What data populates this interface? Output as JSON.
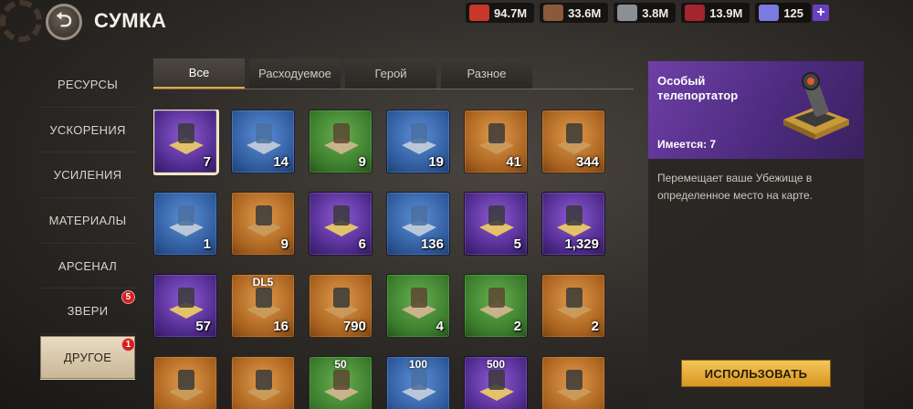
{
  "header": {
    "title": "СУМКА",
    "resources": [
      {
        "icon": "food-icon",
        "value": "94.7M",
        "color": "#c8372a"
      },
      {
        "icon": "wood-icon",
        "value": "33.6M",
        "color": "#8a5a3a"
      },
      {
        "icon": "steel-icon",
        "value": "3.8M",
        "color": "#8b8f96"
      },
      {
        "icon": "fuel-icon",
        "value": "13.9M",
        "color": "#a3252d"
      },
      {
        "icon": "gems-icon",
        "value": "125",
        "color": "#7a7ae0"
      }
    ],
    "plus_label": "+"
  },
  "sidebar": {
    "items": [
      {
        "label": "РЕСУРСЫ",
        "badge": null
      },
      {
        "label": "УСКОРЕНИЯ",
        "badge": null
      },
      {
        "label": "УСИЛЕНИЯ",
        "badge": null
      },
      {
        "label": "МАТЕРИАЛЫ",
        "badge": null
      },
      {
        "label": "АРСЕНАЛ",
        "badge": null
      },
      {
        "label": "ЗВЕРИ",
        "badge": "5"
      },
      {
        "label": "ДРУГОЕ",
        "badge": "1"
      }
    ],
    "active_index": 6
  },
  "tabs": [
    {
      "label": "Все",
      "active": true
    },
    {
      "label": "Расходуемое",
      "active": false
    },
    {
      "label": "Герой",
      "active": false
    },
    {
      "label": "Разное",
      "active": false
    }
  ],
  "items": [
    {
      "name": "teleporter-item",
      "rarity": "purple",
      "qty": "7",
      "selected": true
    },
    {
      "name": "flag-item",
      "rarity": "blue",
      "qty": "14"
    },
    {
      "name": "random-box-item",
      "rarity": "green",
      "qty": "9"
    },
    {
      "name": "map-search-item",
      "rarity": "blue",
      "qty": "19"
    },
    {
      "name": "binoculars-item",
      "rarity": "orange",
      "qty": "41"
    },
    {
      "name": "device-item",
      "rarity": "orange",
      "qty": "344"
    },
    {
      "name": "laptop-item",
      "rarity": "blue",
      "qty": "1"
    },
    {
      "name": "chip-item",
      "rarity": "orange",
      "qty": "9"
    },
    {
      "name": "purple-chip-item",
      "rarity": "purple",
      "qty": "6"
    },
    {
      "name": "blue-chip-item",
      "rarity": "blue",
      "qty": "136"
    },
    {
      "name": "vial-item",
      "rarity": "purple",
      "qty": "5"
    },
    {
      "name": "knife-item",
      "rarity": "purple",
      "qty": "1,329"
    },
    {
      "name": "hook-item",
      "rarity": "purple",
      "qty": "57"
    },
    {
      "name": "dl5-badge-item",
      "rarity": "orange",
      "qty": "16",
      "tag": "DL5"
    },
    {
      "name": "coin-item",
      "rarity": "orange",
      "qty": "790"
    },
    {
      "name": "container-item",
      "rarity": "green",
      "qty": "4"
    },
    {
      "name": "mystery-box-item",
      "rarity": "green",
      "qty": "2"
    },
    {
      "name": "mystery-box-orange-item",
      "rarity": "orange",
      "qty": "2"
    },
    {
      "name": "chest-item",
      "rarity": "orange",
      "qty": ""
    },
    {
      "name": "treasure-chest-item",
      "rarity": "orange",
      "qty": ""
    },
    {
      "name": "can-50-item",
      "rarity": "green",
      "qty": "",
      "tag": "50"
    },
    {
      "name": "can-100-item",
      "rarity": "blue",
      "qty": "",
      "tag": "100"
    },
    {
      "name": "can-500-item",
      "rarity": "purple",
      "qty": "",
      "tag": "500"
    },
    {
      "name": "token-2-item",
      "rarity": "orange",
      "qty": ""
    }
  ],
  "detail": {
    "name": "Особый телепортатор",
    "owned": "Имеется: 7",
    "description": "Перемещает ваше Убежище в определенное место на карте."
  },
  "use_button": "ИСПОЛЬЗОВАТЬ"
}
